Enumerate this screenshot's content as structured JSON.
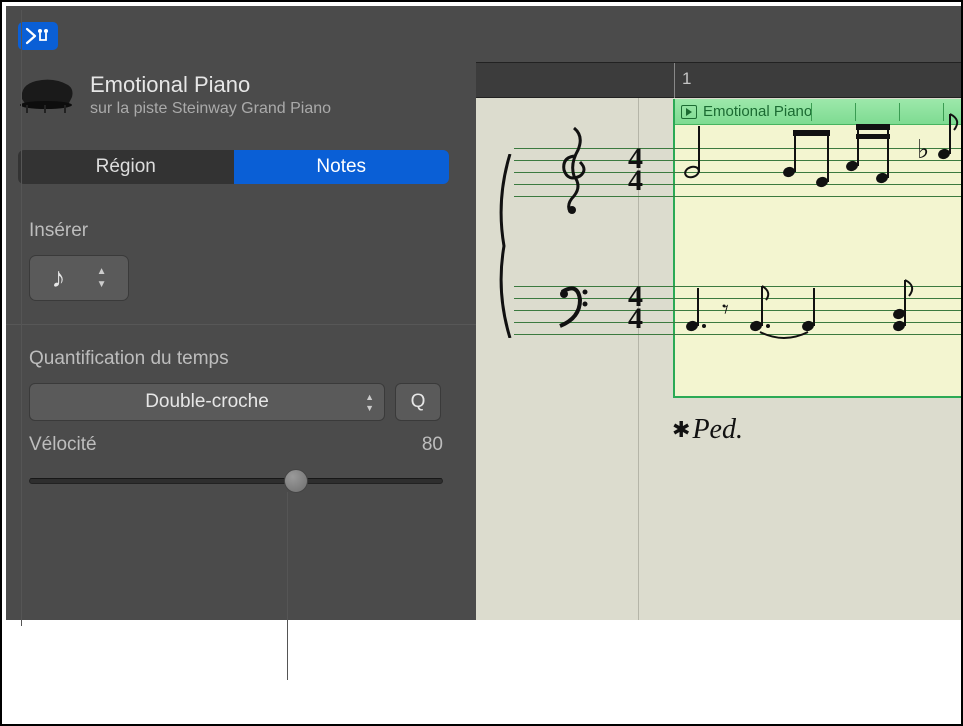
{
  "header": {
    "track_title": "Emotional Piano",
    "track_sub": "sur la piste Steinway Grand Piano"
  },
  "tabs": {
    "region": "Région",
    "notes": "Notes"
  },
  "insert": {
    "label": "Insérer",
    "note_glyph": "♪"
  },
  "quant": {
    "label": "Quantification du temps",
    "value": "Double-croche",
    "q_label": "Q"
  },
  "velocity": {
    "label": "Vélocité",
    "value": "80"
  },
  "ruler": {
    "bar": "1"
  },
  "region": {
    "name": "Emotional Piano"
  },
  "staff": {
    "pedal": "Ped.",
    "timesig_top": "4",
    "timesig_bottom": "4"
  }
}
